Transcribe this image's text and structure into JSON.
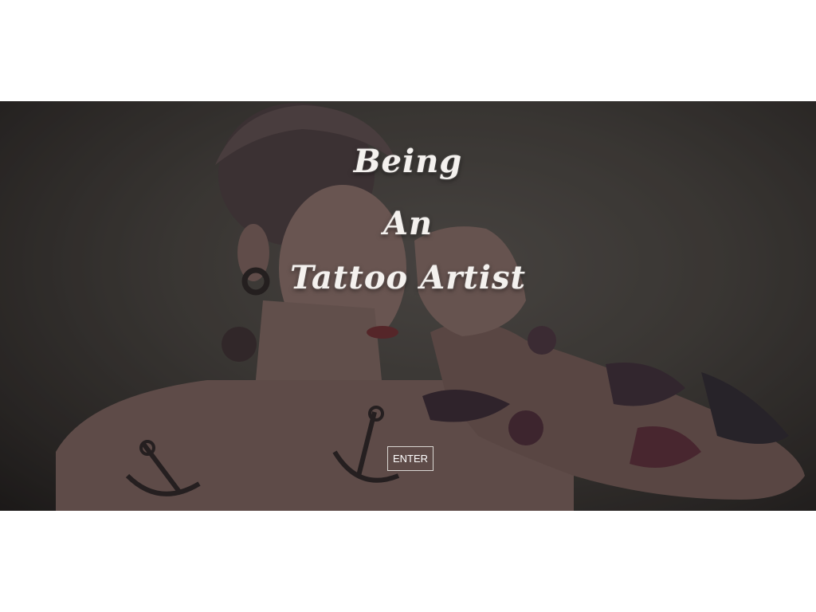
{
  "hero": {
    "title_line_1": "Being",
    "title_line_2": "An",
    "title_line_3": "Tattoo Artist",
    "enter_label": "ENTER"
  }
}
